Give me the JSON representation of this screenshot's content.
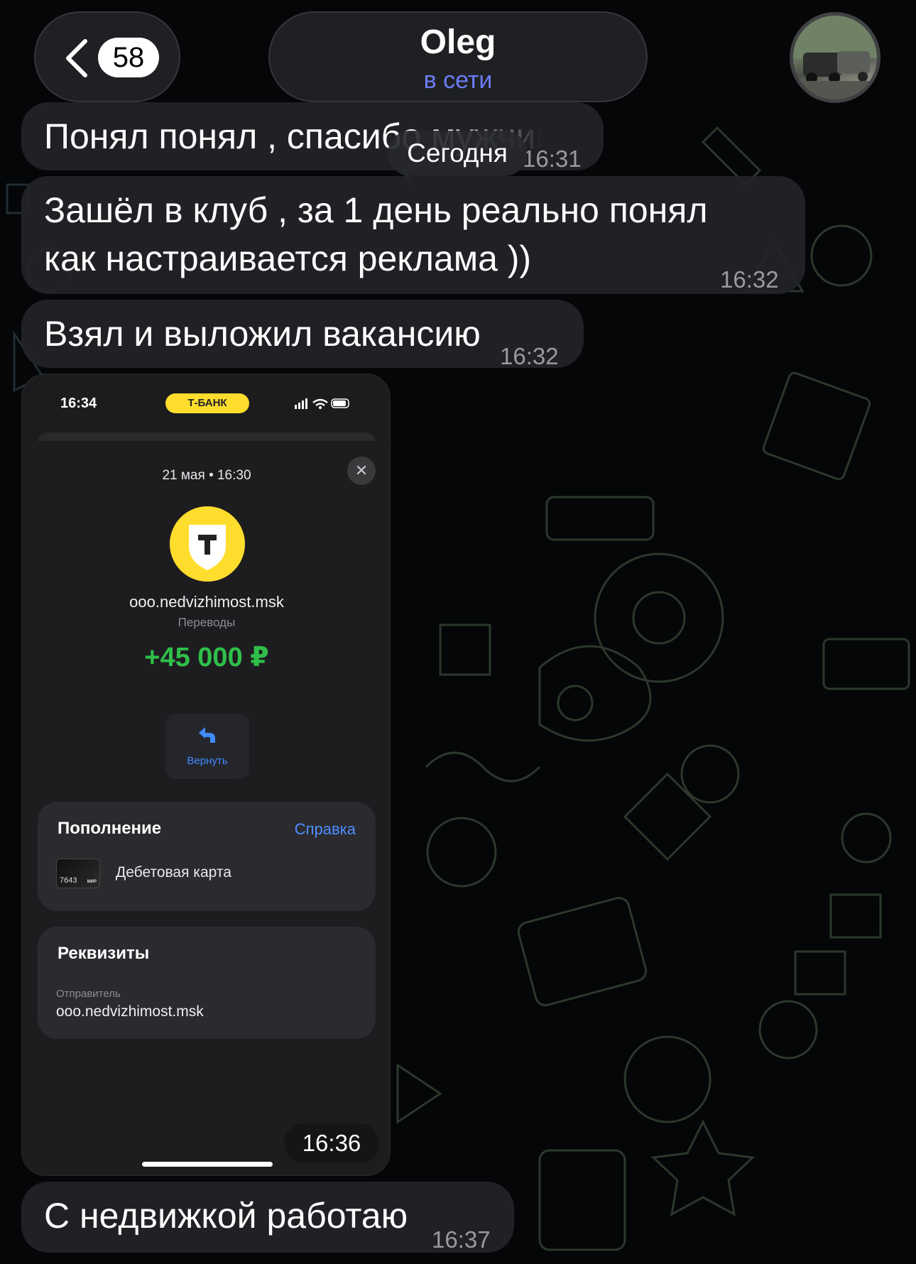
{
  "header": {
    "unread_count": "58",
    "title": "Oleg",
    "status": "в сети"
  },
  "date_separator": "Сегодня",
  "messages": [
    {
      "text": "Понял понял , спасибо мужчина",
      "time": "16:31"
    },
    {
      "text": "Зашёл в клуб , за 1 день реально понял как настраивается реклама ))",
      "time": "16:32"
    },
    {
      "text": "Взял и выложил вакансию",
      "time": "16:32"
    },
    {
      "text": "С недвижкой работаю",
      "time": "16:37"
    }
  ],
  "image_message": {
    "time": "16:36",
    "phone": {
      "status_time": "16:34",
      "bank_pill": "Т-БАНК",
      "operation_date": "21 мая • 16:30",
      "payee": "ooo.nedvizhimost.msk",
      "category": "Переводы",
      "amount": "+45 000 ₽",
      "amount_color": "#2fbf4a",
      "refund_label": "Вернуть",
      "topup": {
        "title": "Пополнение",
        "help": "Справка",
        "card_number": "7643",
        "card_brand": "МИР",
        "card_name": "Дебетовая карта"
      },
      "requisites": {
        "title": "Реквизиты",
        "sender_label": "Отправитель",
        "sender_value": "ooo.nedvizhimost.msk"
      }
    }
  }
}
